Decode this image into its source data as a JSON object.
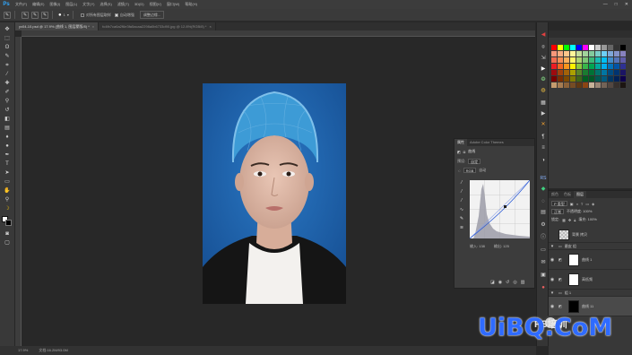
{
  "app": {
    "logo": "Ps"
  },
  "menu": [
    "文件(F)",
    "编辑(E)",
    "图像(I)",
    "图层(L)",
    "文字(Y)",
    "选择(S)",
    "滤镜(T)",
    "3D(D)",
    "视图(V)",
    "窗口(W)",
    "帮助(H)"
  ],
  "window_controls": [
    "—",
    "□",
    "✕"
  ],
  "options": {
    "brush_size": "1",
    "sample_all_layers": "对所有图层取样",
    "auto_enhance": "自动增强",
    "refine_edge": "调整边缘..."
  },
  "tabs": [
    {
      "label": "yx04-10.psd @ 17.9% (曲线 1, 图层蒙版/8) *",
      "active": true
    },
    {
      "label": "fc4fb7ca6a2f6e3fa5acaa2298a0b6733d90.jpg @ 12.8%(RGB/8) *",
      "active": false
    }
  ],
  "curves_panel": {
    "tabs": [
      "属性",
      "Adobe Color Themes"
    ],
    "title": "曲线",
    "preset_label": "预设:",
    "preset_value": "自定",
    "channel_value": "RGB",
    "auto_label": "自动",
    "input_label": "输入: 138",
    "output_label": "输出: 125"
  },
  "layers_panel": {
    "tabs": [
      "颜色",
      "色板",
      "图层"
    ],
    "kind_label": "P 类型",
    "blend_mode": "正常",
    "opacity_label": "不透明度: 100%",
    "lock_label": "锁定:",
    "fill_label": "填充: 100%",
    "layers": [
      {
        "name": "背景 拷贝",
        "type": "pixel"
      },
      {
        "name": "磨皮 组",
        "type": "group"
      },
      {
        "name": "曲线 1",
        "type": "adjustment"
      },
      {
        "name": "高低频",
        "type": "adjustment"
      },
      {
        "name": "组 1",
        "type": "group"
      },
      {
        "name": "曲线 11",
        "type": "adjustment"
      }
    ]
  },
  "status": {
    "zoom": "17.9%",
    "doc": "文档:16.2M/93.0M"
  },
  "watermark": {
    "brand": "UiBQ.CoM",
    "cn": "PS培训"
  },
  "colors": {
    "accent": "#31a8ff",
    "bg": "#282828",
    "panel": "#383838",
    "photo_bg": "#1e5fa8"
  }
}
